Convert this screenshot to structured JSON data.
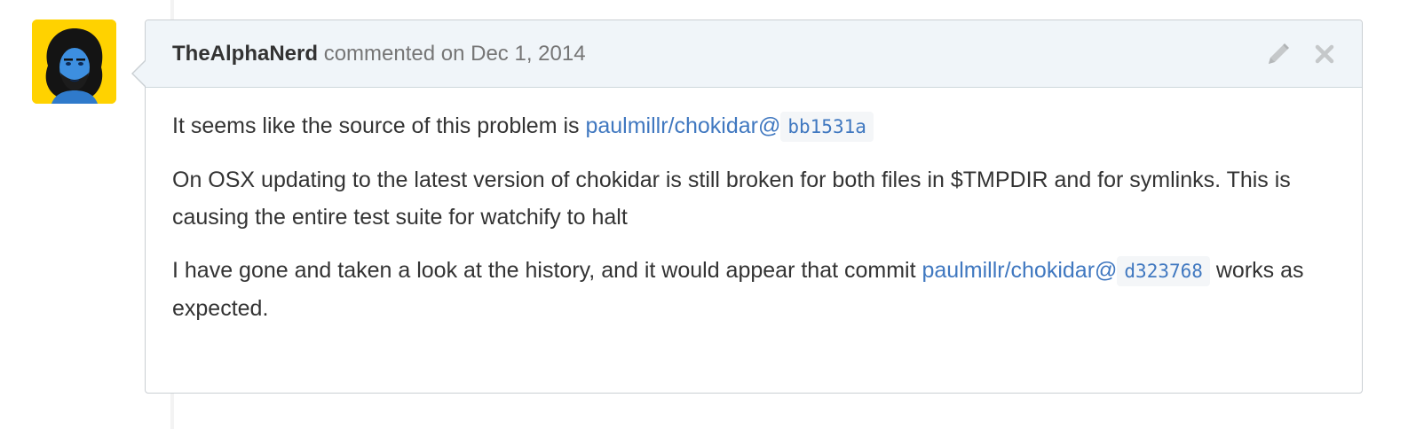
{
  "comment": {
    "author": "TheAlphaNerd",
    "action_text": "commented on",
    "date": "Dec 1, 2014",
    "paragraphs": [
      {
        "text_before": "It seems like the source of this problem is ",
        "link_text": "paulmillr/chokidar@",
        "sha": "bb1531a",
        "text_after": ""
      },
      {
        "text": "On OSX updating to the latest version of chokidar is still broken for both files in $TMPDIR and for symlinks. This is causing the entire test suite for watchify to halt"
      },
      {
        "text_before": "I have gone and taken a look at the history, and it would appear that commit ",
        "link_text": "paulmillr/chokidar@",
        "sha": "d323768",
        "text_after": " works as expected."
      }
    ]
  },
  "icons": {
    "edit": "pencil-icon",
    "delete": "close-icon"
  },
  "colors": {
    "avatar_bg": "#ffd200",
    "header_bg": "#f0f5f9",
    "link": "#4078c0",
    "border": "#cacfd3"
  }
}
